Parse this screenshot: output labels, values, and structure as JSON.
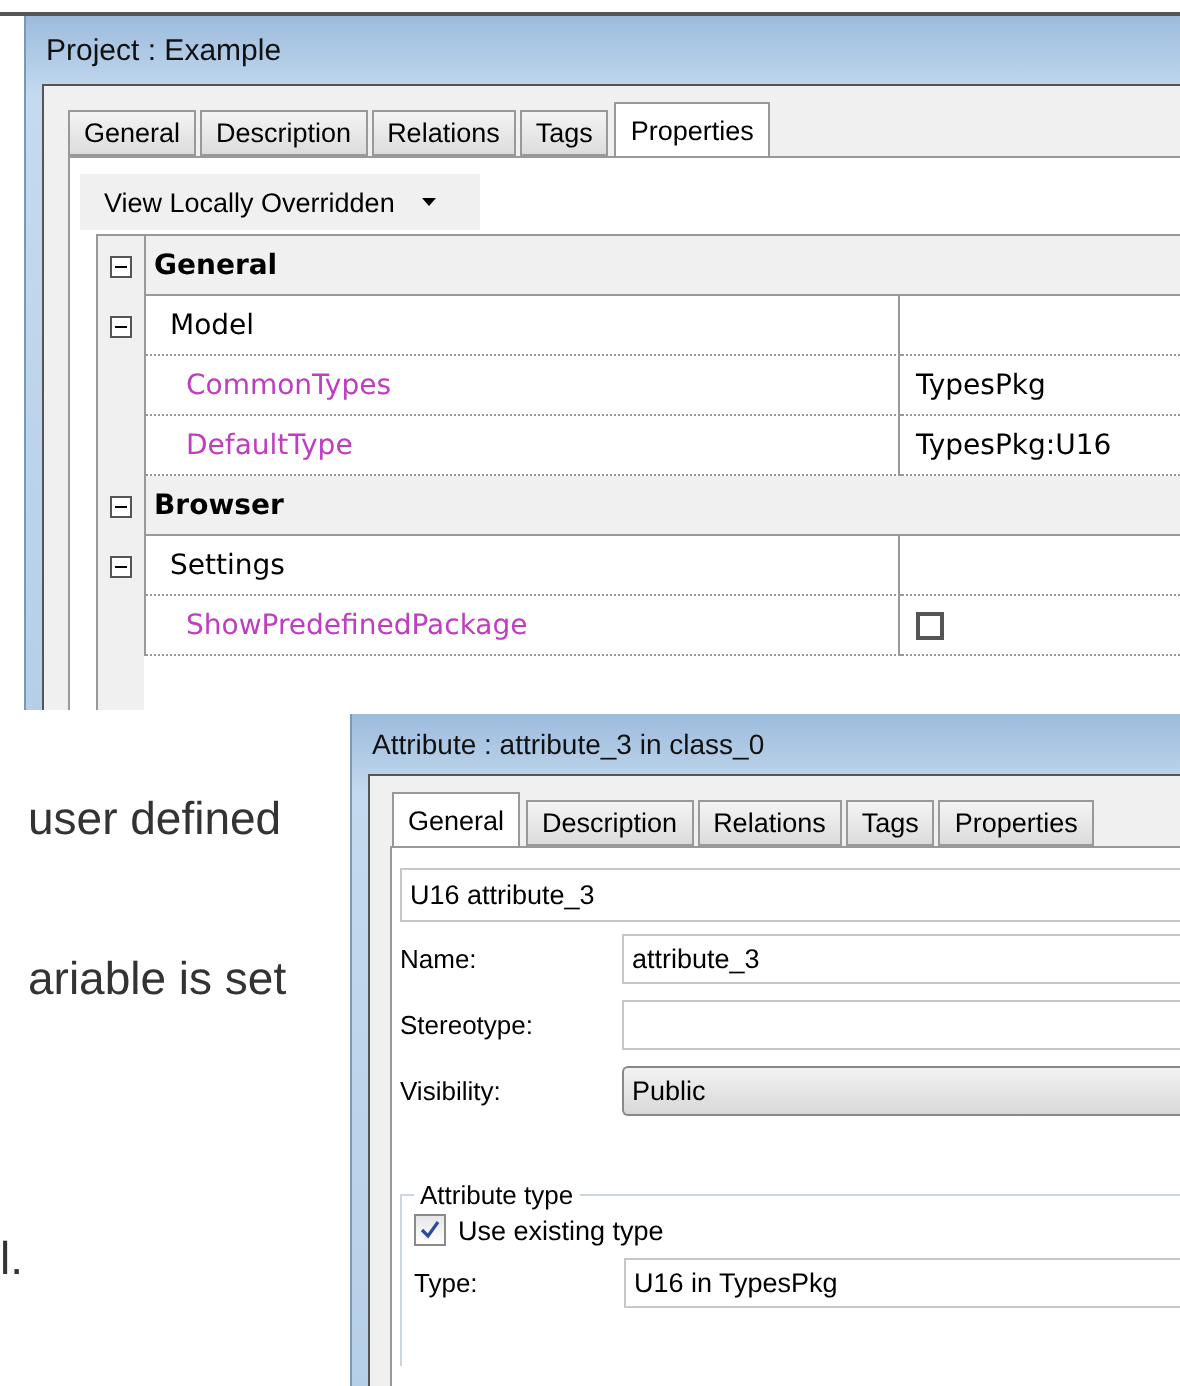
{
  "top_dialog": {
    "title": "Project : Example",
    "tabs": [
      {
        "label": "General",
        "selected": false
      },
      {
        "label": "Description",
        "selected": false
      },
      {
        "label": "Relations",
        "selected": false
      },
      {
        "label": "Tags",
        "selected": false
      },
      {
        "label": "Properties",
        "selected": true
      }
    ],
    "view_menu": {
      "label": "View Locally Overridden"
    },
    "rows": [
      {
        "kind": "category",
        "label": "General",
        "expanded": true
      },
      {
        "kind": "group",
        "label": "Model",
        "expanded": true
      },
      {
        "kind": "property",
        "label": "CommonTypes",
        "value": "TypesPkg"
      },
      {
        "kind": "property",
        "label": "DefaultType",
        "value": "TypesPkg:U16"
      },
      {
        "kind": "category",
        "label": "Browser",
        "expanded": true
      },
      {
        "kind": "group",
        "label": "Settings",
        "expanded": true
      },
      {
        "kind": "check",
        "label": "ShowPredefinedPackage",
        "checked": false
      }
    ]
  },
  "body_text": [
    "user defined",
    "ariable is set",
    "l."
  ],
  "bottom_dialog": {
    "title": "Attribute : attribute_3 in class_0",
    "tabs": [
      {
        "label": "General",
        "selected": true
      },
      {
        "label": "Description",
        "selected": false
      },
      {
        "label": "Relations",
        "selected": false
      },
      {
        "label": "Tags",
        "selected": false
      },
      {
        "label": "Properties",
        "selected": false
      }
    ],
    "summary": "U16 attribute_3",
    "fields": [
      {
        "kind": "text",
        "label": "Name:",
        "value": "attribute_3"
      },
      {
        "kind": "text",
        "label": "Stereotype:"
      },
      {
        "kind": "combo",
        "label": "Visibility:",
        "value": "Public"
      }
    ],
    "group": {
      "title": "Attribute type",
      "checkbox": {
        "label": "Use existing type",
        "checked": true
      },
      "type_label": "Type:",
      "type_value": "U16 in TypesPkg"
    }
  }
}
